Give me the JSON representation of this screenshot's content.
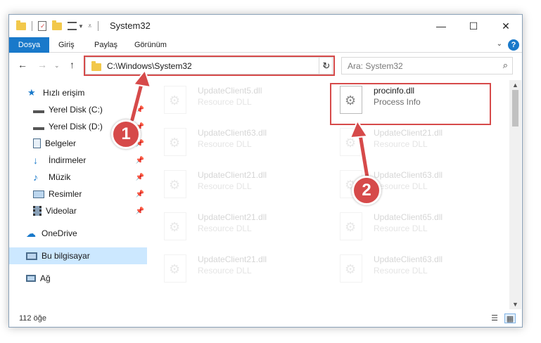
{
  "window": {
    "title": "System32",
    "controls": {
      "minimize": "—",
      "maximize": "☐",
      "close": "✕"
    }
  },
  "ribbon": {
    "tabs": [
      {
        "label": "Dosya",
        "active": true
      },
      {
        "label": "Giriş"
      },
      {
        "label": "Paylaş"
      },
      {
        "label": "Görünüm"
      }
    ],
    "help": "?"
  },
  "nav": {
    "address": "C:\\Windows\\System32",
    "search_placeholder": "Ara: System32"
  },
  "sidebar": {
    "items": [
      {
        "label": "Hızlı erişim",
        "icon": "star-icon"
      },
      {
        "label": "Yerel Disk (C:)",
        "icon": "drive-icon",
        "pinned": true
      },
      {
        "label": "Yerel Disk (D:)",
        "icon": "drive-icon",
        "pinned": true
      },
      {
        "label": "Belgeler",
        "icon": "document-icon",
        "pinned": true
      },
      {
        "label": "İndirmeler",
        "icon": "download-icon",
        "pinned": true
      },
      {
        "label": "Müzik",
        "icon": "music-icon",
        "pinned": true
      },
      {
        "label": "Resimler",
        "icon": "pictures-icon",
        "pinned": true
      },
      {
        "label": "Videolar",
        "icon": "video-icon",
        "pinned": true
      },
      {
        "label": "OneDrive",
        "icon": "cloud-icon"
      },
      {
        "label": "Bu bilgisayar",
        "icon": "computer-icon",
        "selected": true
      },
      {
        "label": "Ağ",
        "icon": "network-icon"
      }
    ]
  },
  "files": {
    "left_column": [
      {
        "name": "UpdateClient5.dll",
        "type": "Resource DLL"
      },
      {
        "name": "UpdateClient63.dll",
        "type": "Resource DLL"
      },
      {
        "name": "UpdateClient21.dll",
        "type": "Resource DLL"
      },
      {
        "name": "UpdateClient21.dll",
        "type": "Resource DLL"
      },
      {
        "name": "UpdateClient21.dll",
        "type": "Resource DLL"
      }
    ],
    "highlighted": {
      "name": "procinfo.dll",
      "type": "Process Info"
    },
    "right_column": [
      {
        "name": "UpdateClient21.dll",
        "type": "Resource DLL"
      },
      {
        "name": "UpdateClient63.dll",
        "type": "Resource DLL"
      },
      {
        "name": "UpdateClient65.dll",
        "type": "Resource DLL"
      },
      {
        "name": "UpdateClient63.dll",
        "type": "Resource DLL"
      }
    ]
  },
  "status": {
    "count": "112 öğe"
  },
  "annotations": {
    "step1": "1",
    "step2": "2"
  },
  "colors": {
    "accent": "#1979ca",
    "annotation": "#d64a4a",
    "selection": "#cce8ff"
  }
}
